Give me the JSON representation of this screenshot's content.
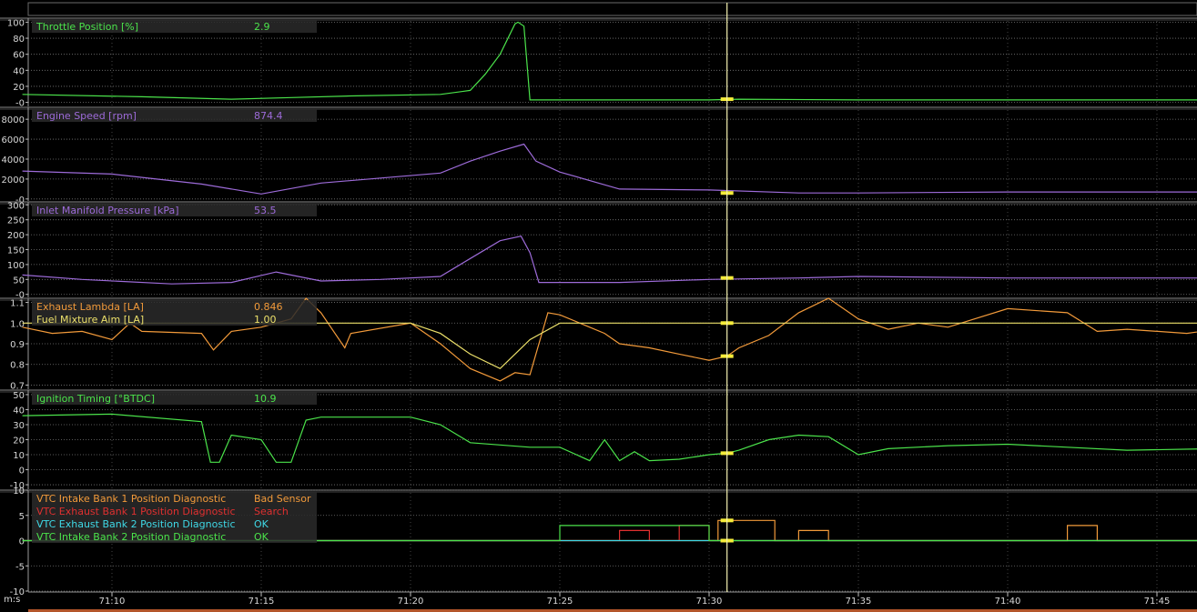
{
  "x_axis": {
    "unit_label": "m:s",
    "ticks": [
      {
        "t": 10,
        "label": "71:10"
      },
      {
        "t": 15,
        "label": "71:15"
      },
      {
        "t": 20,
        "label": "71:20"
      },
      {
        "t": 25,
        "label": "71:25"
      },
      {
        "t": 30,
        "label": "71:30"
      },
      {
        "t": 35,
        "label": "71:35"
      },
      {
        "t": 40,
        "label": "71:40"
      },
      {
        "t": 45,
        "label": "71:45"
      }
    ]
  },
  "cursor_time": 30.6,
  "chart_data": {
    "type": "line",
    "x_unit": "seconds after 71:00",
    "panels": [
      {
        "id": "throttle",
        "ylim": [
          -5,
          105
        ],
        "yticks": [
          {
            "v": 100,
            "label": "100"
          },
          {
            "v": 80,
            "label": "80"
          },
          {
            "v": 60,
            "label": "60"
          },
          {
            "v": 40,
            "label": "40"
          },
          {
            "v": 20,
            "label": "20"
          },
          {
            "v": 0,
            "label": "-0"
          }
        ],
        "series": [
          {
            "name": "Throttle Position [%]",
            "value": "2.9",
            "color": "#4be34b",
            "x": [
              7,
              11,
              14,
              16,
              18,
              21,
              22,
              22.5,
              23,
              23.5,
              23.6,
              23.8,
              24,
              27,
              30,
              31,
              35,
              40,
              47
            ],
            "y": [
              10,
              7,
              4,
              6,
              8,
              10,
              15,
              35,
              60,
              98,
              100,
              95,
              3,
              3,
              3,
              4,
              3,
              3,
              3
            ]
          }
        ]
      },
      {
        "id": "rpm",
        "ylim": [
          -200,
          9200
        ],
        "yticks": [
          {
            "v": 8000,
            "label": "8000"
          },
          {
            "v": 6000,
            "label": "6000"
          },
          {
            "v": 4000,
            "label": "4000"
          },
          {
            "v": 2000,
            "label": "2000"
          },
          {
            "v": 0,
            "label": "-0"
          }
        ],
        "series": [
          {
            "name": "Engine Speed [rpm]",
            "value": "874.4",
            "color": "#9d6bd9",
            "x": [
              7,
              10,
              13,
              15,
              17,
              19,
              21,
              22,
              23,
              23.8,
              24.2,
              25,
              27,
              30,
              33,
              35,
              40,
              47
            ],
            "y": [
              2800,
              2500,
              1500,
              500,
              1600,
              2100,
              2600,
              3800,
              4800,
              5500,
              3800,
              2700,
              1000,
              900,
              600,
              600,
              700,
              700
            ]
          }
        ]
      },
      {
        "id": "map",
        "ylim": [
          -10,
          310
        ],
        "yticks": [
          {
            "v": 300,
            "label": "300"
          },
          {
            "v": 250,
            "label": "250"
          },
          {
            "v": 200,
            "label": "200"
          },
          {
            "v": 150,
            "label": "150"
          },
          {
            "v": 100,
            "label": "100"
          },
          {
            "v": 50,
            "label": "50"
          },
          {
            "v": 0,
            "label": "-0"
          }
        ],
        "series": [
          {
            "name": "Inlet Manifold Pressure [kPa]",
            "value": "53.5",
            "color": "#9d6bd9",
            "x": [
              7,
              9,
              12,
              14,
              15.5,
              17,
              19,
              21,
              22,
              23,
              23.7,
              24,
              24.3,
              27,
              30,
              33,
              35,
              40,
              47
            ],
            "y": [
              65,
              50,
              35,
              40,
              75,
              45,
              50,
              60,
              120,
              180,
              195,
              140,
              40,
              40,
              50,
              55,
              60,
              55,
              55
            ]
          }
        ]
      },
      {
        "id": "lambda",
        "ylim": [
          0.68,
          1.12
        ],
        "yticks": [
          {
            "v": 1.1,
            "label": "1.1"
          },
          {
            "v": 1.0,
            "label": "1.0"
          },
          {
            "v": 0.9,
            "label": "0.9"
          },
          {
            "v": 0.8,
            "label": "0.8"
          },
          {
            "v": 0.7,
            "label": "0.7"
          }
        ],
        "series": [
          {
            "name": "Exhaust Lambda [LA]",
            "value": "0.846",
            "color": "#f29a3a",
            "x": [
              7,
              8,
              9,
              10,
              10.6,
              11,
              13,
              13.4,
              14,
              15,
              16,
              16.5,
              17,
              17.8,
              18,
              20,
              21,
              22,
              23,
              23.5,
              24,
              24.6,
              25,
              26,
              26.5,
              27,
              28,
              29,
              30,
              30.6,
              31,
              32,
              33,
              34,
              35,
              36,
              37,
              38,
              40,
              42,
              43,
              44,
              46,
              47
            ],
            "y": [
              0.98,
              0.95,
              0.96,
              0.92,
              1.0,
              0.96,
              0.95,
              0.87,
              0.96,
              0.98,
              1.02,
              1.12,
              1.05,
              0.88,
              0.95,
              1.0,
              0.9,
              0.78,
              0.72,
              0.76,
              0.75,
              1.05,
              1.04,
              0.98,
              0.95,
              0.9,
              0.88,
              0.85,
              0.82,
              0.84,
              0.88,
              0.94,
              1.05,
              1.12,
              1.02,
              0.97,
              1.0,
              0.98,
              1.07,
              1.05,
              0.96,
              0.97,
              0.95,
              0.97
            ]
          },
          {
            "name": "Fuel Mixture Aim [LA]",
            "value": "1.00",
            "color": "#ece06a",
            "x": [
              7,
              20,
              21,
              22,
              23,
              24,
              25,
              47
            ],
            "y": [
              1.0,
              1.0,
              0.95,
              0.85,
              0.78,
              0.92,
              1.0,
              1.0
            ]
          }
        ]
      },
      {
        "id": "ignition",
        "ylim": [
          -13,
          53
        ],
        "yticks": [
          {
            "v": 50,
            "label": "50"
          },
          {
            "v": 40,
            "label": "40"
          },
          {
            "v": 30,
            "label": "30"
          },
          {
            "v": 20,
            "label": "20"
          },
          {
            "v": 10,
            "label": "10"
          },
          {
            "v": 0,
            "label": "0"
          },
          {
            "v": -10,
            "label": "-10"
          }
        ],
        "series": [
          {
            "name": "Ignition Timing [°BTDC]",
            "value": "10.9",
            "color": "#4be34b",
            "x": [
              7,
              10,
              13,
              13.3,
              13.6,
              14,
              15,
              15.5,
              16,
              16.5,
              17,
              17.5,
              20,
              21,
              22,
              24,
              25,
              26,
              26.5,
              27,
              27.5,
              28,
              29,
              30,
              30.6,
              31,
              32,
              33,
              34,
              35,
              36,
              38,
              40,
              42,
              44,
              47
            ],
            "y": [
              36,
              37,
              32,
              5,
              5,
              23,
              20,
              5,
              5,
              33,
              35,
              35,
              35,
              30,
              18,
              15,
              15,
              6,
              20,
              6,
              12,
              6,
              7,
              10,
              11,
              13,
              20,
              23,
              22,
              10,
              14,
              16,
              17,
              15,
              13,
              14
            ]
          }
        ]
      },
      {
        "id": "vtc",
        "ylim": [
          -10,
          10
        ],
        "yticks": [
          {
            "v": 10,
            "label": "10"
          },
          {
            "v": 5,
            "label": "5"
          },
          {
            "v": 0,
            "label": "0"
          },
          {
            "v": -5,
            "label": "-5"
          },
          {
            "v": -10,
            "label": "-10"
          }
        ],
        "series": [
          {
            "name": "VTC Intake Bank 1 Position Diagnostic",
            "value": "Bad Sensor",
            "color": "#f29a3a",
            "x": [
              7,
              30.3,
              30.3,
              32.2,
              32.2,
              33,
              33,
              34,
              34,
              42,
              42,
              43,
              43,
              47
            ],
            "y": [
              0,
              0,
              4,
              4,
              0,
              0,
              2,
              2,
              0,
              0,
              3,
              3,
              0,
              0
            ]
          },
          {
            "name": "VTC Exhaust Bank 1 Position Diagnostic",
            "value": "Search",
            "color": "#e03030",
            "x": [
              7,
              27,
              27,
              28,
              28,
              29,
              29,
              30,
              30,
              47
            ],
            "y": [
              0,
              0,
              2,
              2,
              0,
              0,
              3,
              3,
              0,
              0
            ]
          },
          {
            "name": "VTC Exhaust Bank 2 Position Diagnostic",
            "value": "OK",
            "color": "#3fd8e6",
            "x": [
              7,
              47
            ],
            "y": [
              0,
              0
            ]
          },
          {
            "name": "VTC Intake Bank 2 Position Diagnostic",
            "value": "OK",
            "color": "#4be34b",
            "x": [
              7,
              25,
              25,
              30,
              30,
              47
            ],
            "y": [
              0,
              0,
              3,
              3,
              0,
              0
            ]
          }
        ]
      }
    ]
  }
}
